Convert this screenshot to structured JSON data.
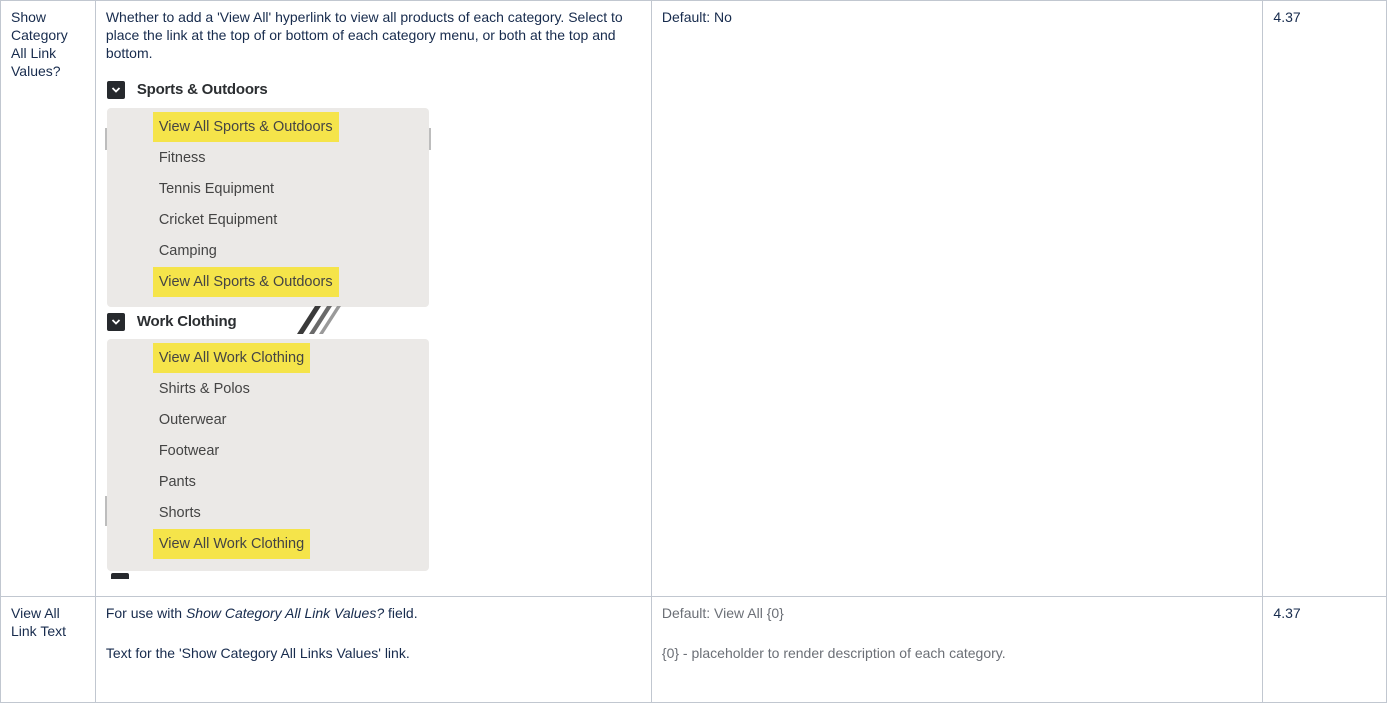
{
  "rows": [
    {
      "field": "Show Category All Link Values?",
      "description": "Whether to add a 'View All' hyperlink to view all products of each category. Select to place the link at the top of or bottom of each category menu, or both at the top and bottom.",
      "default": "Default: No",
      "version": "4.37",
      "screenshot": {
        "groups": [
          {
            "header": "Sports & Outdoors",
            "items": [
              {
                "label": "View All Sports & Outdoors",
                "highlighted": true
              },
              {
                "label": "Fitness",
                "highlighted": false
              },
              {
                "label": "Tennis Equipment",
                "highlighted": false
              },
              {
                "label": "Cricket Equipment",
                "highlighted": false
              },
              {
                "label": "Camping",
                "highlighted": false
              },
              {
                "label": "View All Sports & Outdoors",
                "highlighted": true
              }
            ]
          },
          {
            "header": "Work Clothing",
            "items": [
              {
                "label": "View All Work Clothing",
                "highlighted": true
              },
              {
                "label": "Shirts & Polos",
                "highlighted": false
              },
              {
                "label": "Outerwear",
                "highlighted": false
              },
              {
                "label": "Footwear",
                "highlighted": false
              },
              {
                "label": "Pants",
                "highlighted": false
              },
              {
                "label": "Shorts",
                "highlighted": false
              },
              {
                "label": "View All Work Clothing",
                "highlighted": true
              }
            ]
          }
        ],
        "colors": {
          "highlight": "#f5e44a",
          "panel": "#ebe9e7",
          "chevron": "#26292d"
        },
        "icon": "chevron-down-icon"
      }
    },
    {
      "field": "View All Link Text",
      "description_prefix": "For use with ",
      "description_field_ref": "Show Category All Link Values?",
      "description_suffix": " field.",
      "description_2": "Text for the 'Show Category All Links Values' link.",
      "default": "Default: View All {0}",
      "default_2": "{0} - placeholder to render description of each category.",
      "version": "4.37"
    }
  ]
}
